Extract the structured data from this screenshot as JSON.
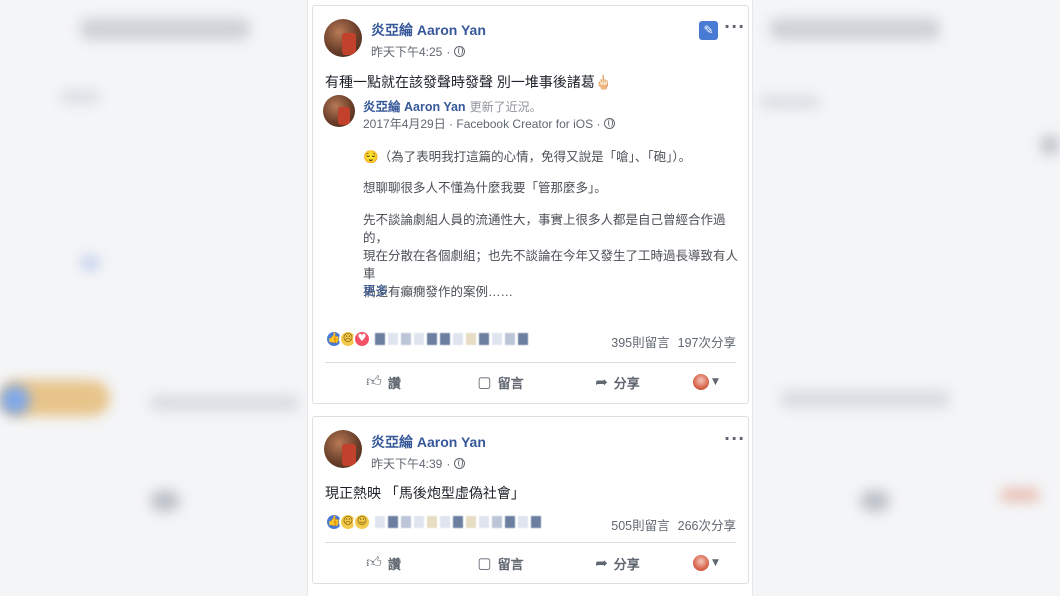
{
  "post1": {
    "author": "炎亞綸 Aaron Yan",
    "time": "昨天下午4:25",
    "text": "有種一點就在該發聲時發聲 別一堆事後諸葛🖕🏻",
    "shared": {
      "author": "炎亞綸 Aaron Yan",
      "note": "更新了近況。",
      "date_source": "2017年4月29日 · Facebook Creator for iOS ·",
      "emoji": "😌",
      "para1": "（為了表明我打這篇的心情，免得又說是「嗆」、「砲」）。",
      "para2": "想聊聊很多人不懂為什麼我要「管那麼多」。",
      "para3_line1": "先不談論劇組人員的流通性大，事實上很多人都是自己曾經合作過的，",
      "para3_line2": "現在分散在各個劇組；也先不談論在今年又發生了工時過長導致有人車",
      "para3_line3": "禍還有癲癇發作的案例……",
      "see_more": "更多"
    },
    "comments": "395則留言",
    "shares": "197次分享"
  },
  "post2": {
    "author": "炎亞綸 Aaron Yan",
    "time": "昨天下午4:39",
    "text": "現正熱映 「馬後炮型虛偽社會」",
    "comments": "505則留言",
    "shares": "266次分享"
  },
  "actions": {
    "like": "讚",
    "comment": "留言",
    "share": "分享"
  },
  "icons": {
    "pin": "pin-icon",
    "more": "more-options-icon",
    "globe": "globe-icon"
  },
  "colors": {
    "name_link": "#365899",
    "like_blue": "#4a7bd4"
  }
}
